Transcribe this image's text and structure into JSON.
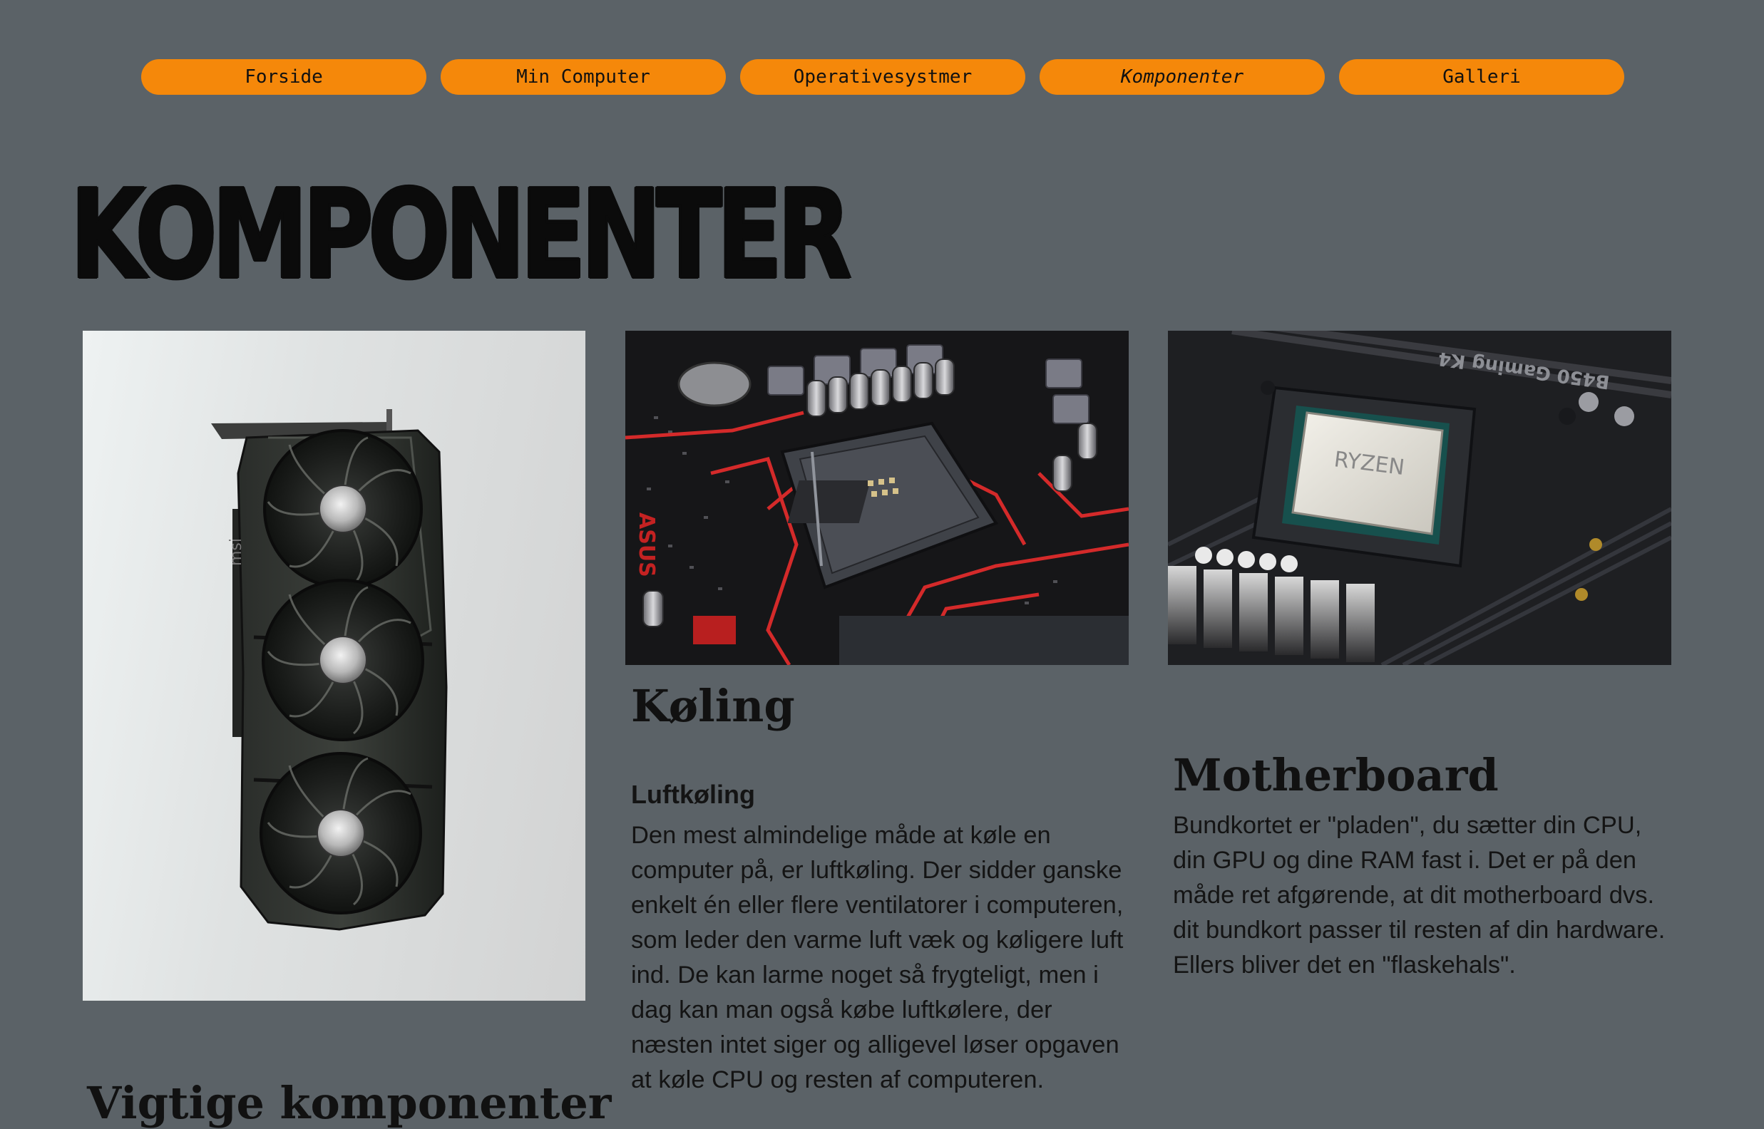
{
  "nav": {
    "items": [
      {
        "label": "Forside"
      },
      {
        "label": "Min Computer"
      },
      {
        "label": "Operativesystmer"
      },
      {
        "label": "Komponenter"
      },
      {
        "label": "Galleri"
      }
    ]
  },
  "page": {
    "title": "KOMPONENTER"
  },
  "cooling": {
    "heading": "Køling",
    "subheading": "Luftkøling",
    "text": "Den mest almindelige måde at køle en computer på, er luftkøling. Der sidder ganske enkelt én eller flere ventilatorer i computeren, som leder den varme luft væk og køligere luft ind. De kan larme noget så frygteligt, men i dag kan man også købe luftkølere, der næsten intet siger og alligevel løser opgaven at køle CPU og resten af computeren."
  },
  "motherboard": {
    "heading": "Motherboard",
    "text": "Bundkortet er \"pladen\", du sætter din CPU, din GPU og dine RAM fast i. Det er på den måde ret afgørende, at dit motherboard dvs. dit bundkort passer til resten af din hardware. Ellers bliver det en \"flaskehals\"."
  },
  "important": {
    "heading": "Vigtige komponenter"
  },
  "images": {
    "gpu_brand": "msi",
    "mobo_brand": "B450 Gaming K4",
    "cpu_brand": "RYZEN",
    "socket_brand": "ASUS"
  },
  "colors": {
    "background": "#5b6267",
    "nav_button": "#f5880a",
    "text": "#111111"
  }
}
